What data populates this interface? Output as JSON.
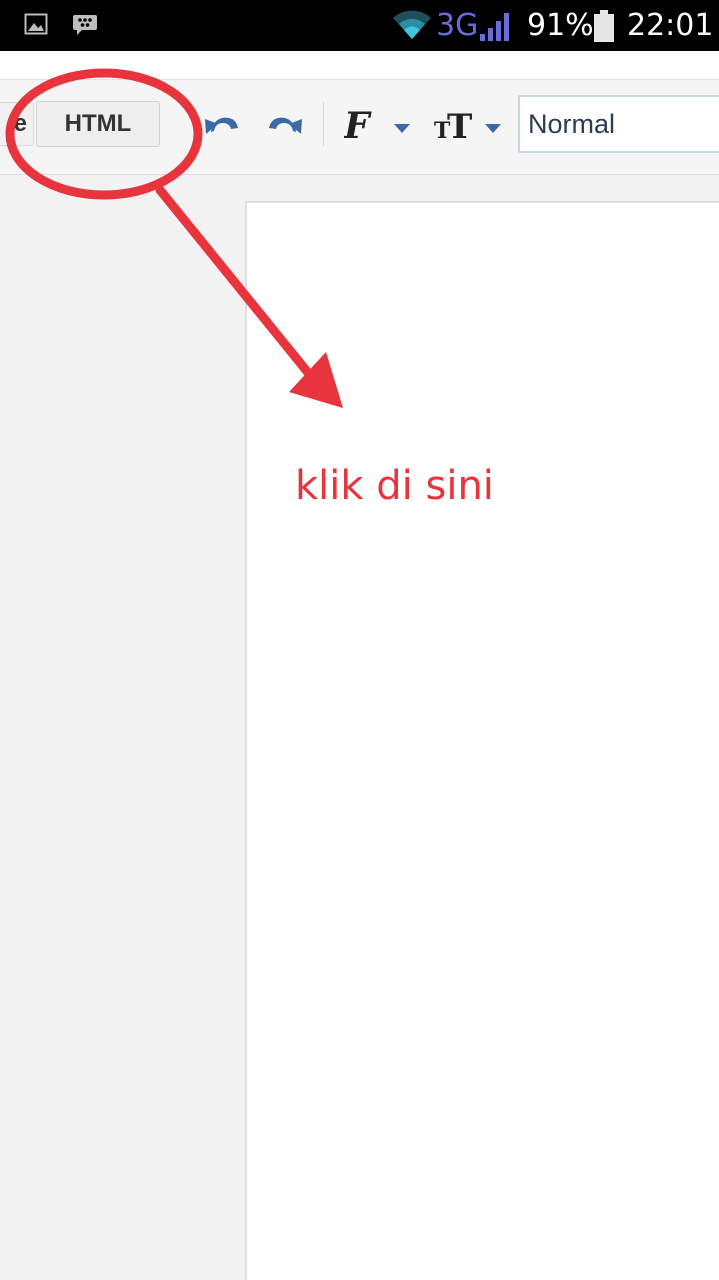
{
  "status_bar": {
    "network_type": "3G",
    "battery_percent": "91%",
    "battery_level": 0.91,
    "time": "22:01",
    "icons": [
      "gallery-icon",
      "bbm-icon",
      "wifi-icon",
      "signal-icon",
      "battery-icon"
    ]
  },
  "toolbar": {
    "compose_tab_partial": "e",
    "html_tab_label": "HTML",
    "format_select_value": "Normal",
    "icons": [
      "undo-icon",
      "redo-icon",
      "font-family-icon",
      "font-size-icon",
      "chevron-down-icon"
    ]
  },
  "annotation": {
    "label": "klik di sini",
    "color": "#e8343c"
  },
  "colors": {
    "toolbar_icon": "#3c6aa8",
    "select_text": "#2b3d52",
    "annotation_red": "#e8343c"
  }
}
